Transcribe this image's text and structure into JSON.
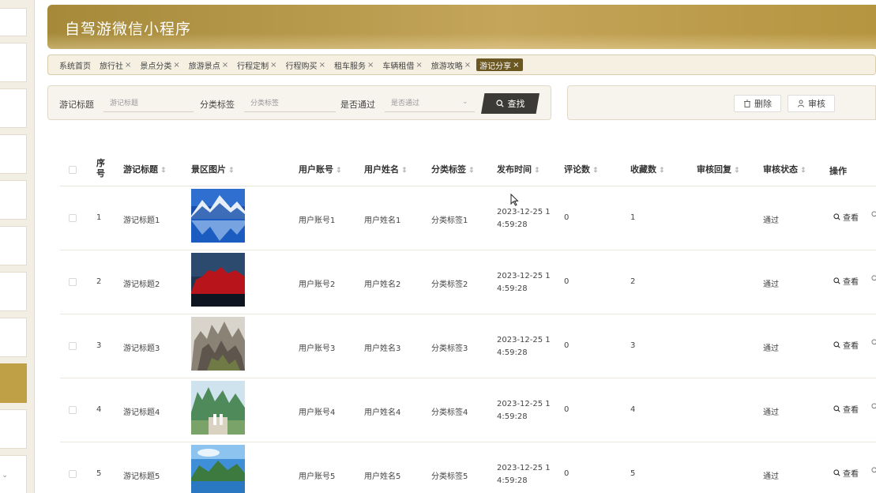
{
  "header": {
    "title": "自驾游微信小程序"
  },
  "tabs": [
    {
      "label": "系统首页",
      "closable": false,
      "active": false
    },
    {
      "label": "旅行社",
      "closable": true,
      "active": false
    },
    {
      "label": "景点分类",
      "closable": true,
      "active": false
    },
    {
      "label": "旅游景点",
      "closable": true,
      "active": false
    },
    {
      "label": "行程定制",
      "closable": true,
      "active": false
    },
    {
      "label": "行程购买",
      "closable": true,
      "active": false
    },
    {
      "label": "租车服务",
      "closable": true,
      "active": false
    },
    {
      "label": "车辆租借",
      "closable": true,
      "active": false
    },
    {
      "label": "旅游攻略",
      "closable": true,
      "active": false
    },
    {
      "label": "游记分享",
      "closable": true,
      "active": true
    }
  ],
  "tab_close": "×",
  "search": {
    "title_label": "游记标题",
    "title_placeholder": "游记标题",
    "tag_label": "分类标签",
    "tag_placeholder": "分类标签",
    "pass_label": "是否通过",
    "pass_placeholder": "是否通过",
    "search_button": "查找"
  },
  "actions": {
    "delete_button": "删除",
    "review_button": "审核"
  },
  "columns": {
    "seq": "序号",
    "title": "游记标题",
    "image": "景区图片",
    "account": "用户账号",
    "name": "用户姓名",
    "tag": "分类标签",
    "time": "发布时间",
    "comments": "评论数",
    "favorites": "收藏数",
    "reply": "审核回复",
    "status": "审核状态",
    "ops": "操作"
  },
  "sort_glyph": "⇕",
  "view_label": "查看",
  "rows": [
    {
      "seq": "1",
      "title": "游记标题1",
      "account": "用户账号1",
      "name": "用户姓名1",
      "tag": "分类标签1",
      "time": "2023-12-25 14:59:28",
      "comments": "0",
      "favorites": "1",
      "reply": "",
      "status": "通过",
      "image": "blue-mountain-lake"
    },
    {
      "seq": "2",
      "title": "游记标题2",
      "account": "用户账号2",
      "name": "用户姓名2",
      "tag": "分类标签2",
      "time": "2023-12-25 14:59:28",
      "comments": "0",
      "favorites": "2",
      "reply": "",
      "status": "通过",
      "image": "red-rock-night-sky"
    },
    {
      "seq": "3",
      "title": "游记标题3",
      "account": "用户账号3",
      "name": "用户姓名3",
      "tag": "分类标签3",
      "time": "2023-12-25 14:59:28",
      "comments": "0",
      "favorites": "3",
      "reply": "",
      "status": "通过",
      "image": "rocky-cliffs"
    },
    {
      "seq": "4",
      "title": "游记标题4",
      "account": "用户账号4",
      "name": "用户姓名4",
      "tag": "分类标签4",
      "time": "2023-12-25 14:59:28",
      "comments": "0",
      "favorites": "4",
      "reply": "",
      "status": "通过",
      "image": "green-peaks-couple"
    },
    {
      "seq": "5",
      "title": "游记标题5",
      "account": "用户账号5",
      "name": "用户姓名5",
      "tag": "分类标签5",
      "time": "2023-12-25 14:59:28",
      "comments": "0",
      "favorites": "5",
      "reply": "",
      "status": "通过",
      "image": "lake-mountains-sky"
    }
  ],
  "colors": {
    "accent": "#bfa047",
    "accent_dark": "#6a5722",
    "search_button": "#3c3a36",
    "header_gradient_start": "#a68a3a",
    "header_gradient_end": "#c4a55a"
  }
}
